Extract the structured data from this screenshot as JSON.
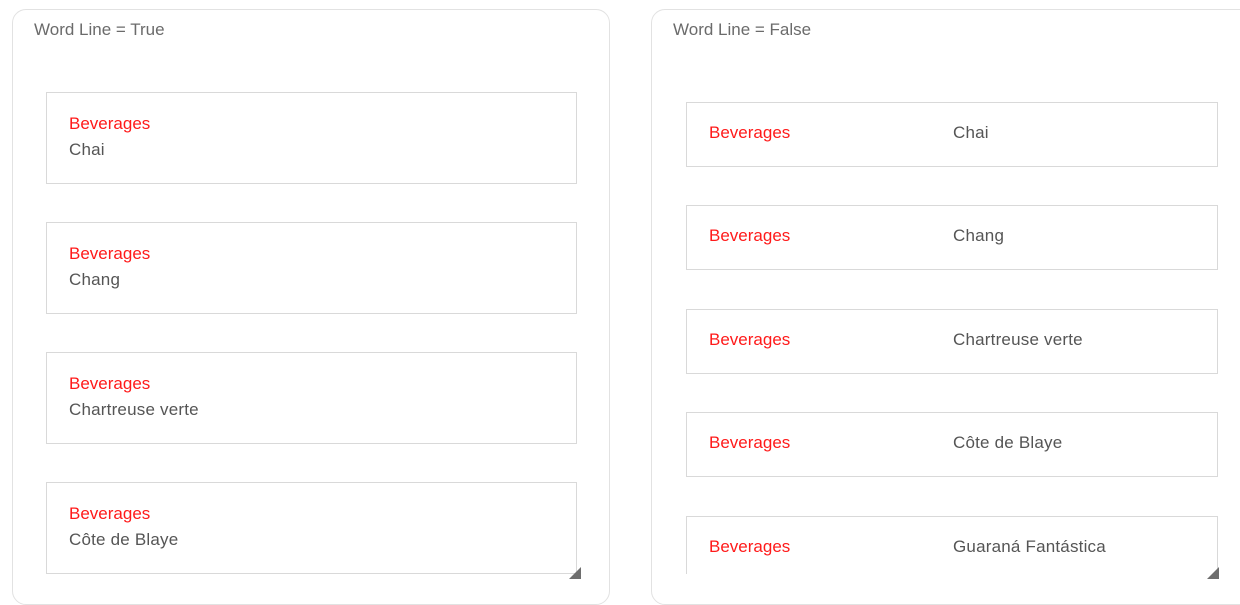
{
  "panels": [
    {
      "title": "Word Line = True",
      "items": [
        {
          "category": "Beverages",
          "name": "Chai"
        },
        {
          "category": "Beverages",
          "name": "Chang"
        },
        {
          "category": "Beverages",
          "name": "Chartreuse verte"
        },
        {
          "category": "Beverages",
          "name": "Côte de Blaye"
        }
      ]
    },
    {
      "title": "Word Line = False",
      "items": [
        {
          "category": "Beverages",
          "name": "Chai"
        },
        {
          "category": "Beverages",
          "name": "Chang"
        },
        {
          "category": "Beverages",
          "name": "Chartreuse verte"
        },
        {
          "category": "Beverages",
          "name": "Côte de Blaye"
        },
        {
          "category": "Beverages",
          "name": "Guaraná Fantástica"
        }
      ]
    }
  ],
  "icons": {
    "resize_grip": "resize-grip-icon"
  },
  "colors": {
    "category_text": "#ff1a1a",
    "name_text": "#555555",
    "title_text": "#6b6b6b",
    "border": "#d9d9d9"
  }
}
